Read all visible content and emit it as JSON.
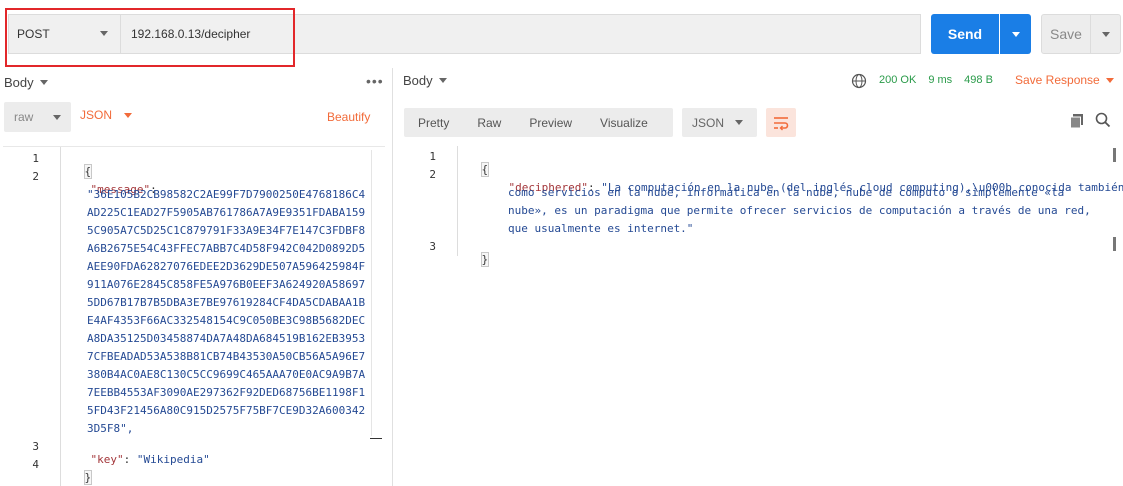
{
  "request": {
    "method": "POST",
    "url": "192.168.0.13/decipher",
    "send_label": "Send",
    "save_label": "Save"
  },
  "request_body": {
    "tab_label": "Body",
    "more_label": "•••",
    "format_raw": "raw",
    "format_lang": "JSON",
    "beautify_label": "Beautify",
    "line_numbers": [
      "1",
      "2",
      "3",
      "4"
    ],
    "open_brace": "{",
    "close_brace": "}",
    "message_key": "\"message\"",
    "colon": ":",
    "message_chunks": [
      "\"36E105B2CB98582C2AE99F7D7900250E4768186C4",
      "AD225C1EAD27F5905AB761786A7A9E9351FDABA159",
      "5C905A7C5D25C1C879791F33A9E34F7E147C3FDBF8",
      "A6B2675E54C43FFEC7ABB7C4D58F942C042D0892D5",
      "AEE90FDA62827076EDEE2D3629DE507A596425984F",
      "911A076E2845C858FE5A976B0EEF3A624920A58697",
      "5DD67B17B7B5DBA3E7BE97619284CF4DA5CDABAA1B",
      "E4AF4353F66AC332548154C9C050BE3C98B5682DEC",
      "A8DA35125D03458874DA7A48DA684519B162EB3953",
      "7CFBEADAD53A538B81CB74B43530A50CB56A5A96E7",
      "380B4AC0AE8C130C5CC9699C465AAA70E0AC9A9B7A",
      "7EEBB4553AF3090AE297362F92DED68756BE1198F1",
      "5FD43F21456A80C915D2575F75BF7CE9D32A600342",
      "3D5F8\","
    ],
    "key_key": "\"key\"",
    "key_value": "\"Wikipedia\""
  },
  "response": {
    "tab_label": "Body",
    "status": "200 OK",
    "time": "9 ms",
    "size": "498 B",
    "save_response_label": "Save Response",
    "view_tabs": [
      "Pretty",
      "Raw",
      "Preview",
      "Visualize"
    ],
    "format": "JSON",
    "line_numbers": [
      "1",
      "2",
      "3"
    ],
    "open_brace": "{",
    "close_brace": "}",
    "deciphered_key": "\"deciphered\"",
    "colon": ":",
    "deciphered_lines": [
      "\"La computación en la nube (del inglés cloud computing),\\u000b conocida también",
      "como servicios en la nube, informática en la nube, nube de cómputo o simplemente «la",
      "nube», es un paradigma que permite ofrecer servicios de computación a través de una red,",
      "que usualmente es internet.\""
    ]
  },
  "colors": {
    "accent_orange": "#f26b3a",
    "send_blue": "#1a7ee6",
    "status_green": "#2a9b4a",
    "highlight_red": "#e2272a",
    "json_key": "#a3363a",
    "json_string": "#254a94"
  }
}
